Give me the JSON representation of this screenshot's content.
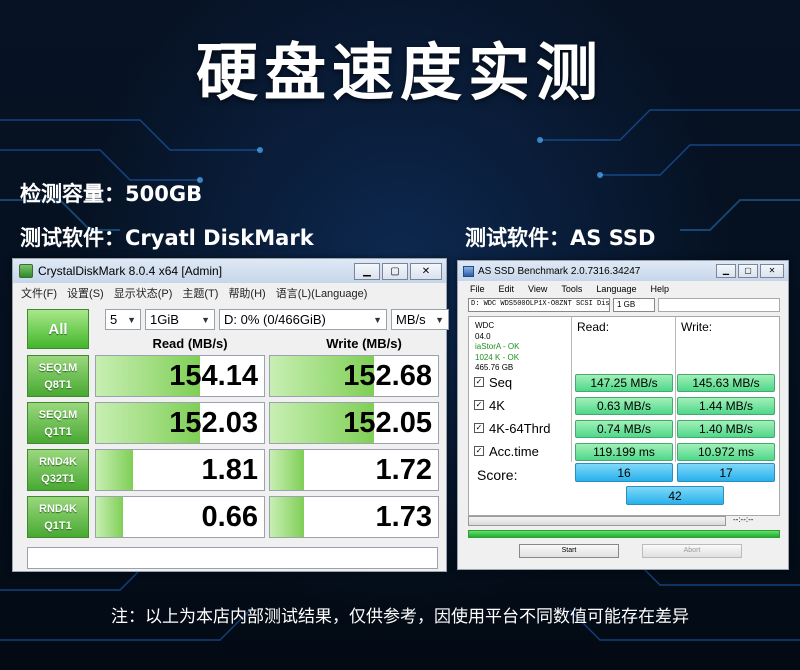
{
  "title": "硬盘速度实测",
  "specs": {
    "capacity": "检测容量：500GB",
    "software_cdm": "测试软件：Cryatl DiskMark",
    "software_asssd": "测试软件：AS SSD"
  },
  "note": "注：以上为本店内部测试结果，仅供参考，因使用平台不同数值可能存在差异",
  "cdm": {
    "title": "CrystalDiskMark 8.0.4 x64 [Admin]",
    "menu": [
      "文件(F)",
      "设置(S)",
      "显示状态(P)",
      "主题(T)",
      "帮助(H)",
      "语言(L)(Language)"
    ],
    "all_label": "All",
    "count": "5",
    "size": "1GiB",
    "drive": "D: 0% (0/466GiB)",
    "unit": "MB/s",
    "read_header": "Read (MB/s)",
    "write_header": "Write (MB/s)",
    "rows": [
      {
        "l1": "SEQ1M",
        "l2": "Q8T1",
        "read": "154.14",
        "write": "152.68",
        "read_fill": 0.62,
        "write_fill": 0.62
      },
      {
        "l1": "SEQ1M",
        "l2": "Q1T1",
        "read": "152.03",
        "write": "152.05",
        "read_fill": 0.62,
        "write_fill": 0.62
      },
      {
        "l1": "RND4K",
        "l2": "Q32T1",
        "read": "1.81",
        "write": "1.72",
        "read_fill": 0.22,
        "write_fill": 0.2
      },
      {
        "l1": "RND4K",
        "l2": "Q1T1",
        "read": "0.66",
        "write": "1.73",
        "read_fill": 0.16,
        "write_fill": 0.2
      }
    ]
  },
  "asssd": {
    "title": "AS SSD Benchmark 2.0.7316.34247",
    "menu": [
      "File",
      "Edit",
      "View",
      "Tools",
      "Language",
      "Help"
    ],
    "drive": "D: WDC WDS500OLP1X-O8ZNT SCSI Disk",
    "size": "1 GB",
    "info": {
      "model": "WDC",
      "fw": "04.0",
      "driver": "iaStorA - OK",
      "align": "1024 K - OK",
      "capacity": "465.76 GB"
    },
    "read_header": "Read:",
    "write_header": "Write:",
    "rows": [
      {
        "label": "Seq",
        "read": "147.25 MB/s",
        "write": "145.63 MB/s"
      },
      {
        "label": "4K",
        "read": "0.63 MB/s",
        "write": "1.44 MB/s"
      },
      {
        "label": "4K-64Thrd",
        "read": "0.74 MB/s",
        "write": "1.40 MB/s"
      },
      {
        "label": "Acc.time",
        "read": "119.199 ms",
        "write": "10.972 ms"
      }
    ],
    "score_label": "Score:",
    "score_read": "16",
    "score_write": "17",
    "score_total": "42",
    "timer": "--:--:--",
    "start_label": "Start",
    "abort_label": "Abort"
  }
}
